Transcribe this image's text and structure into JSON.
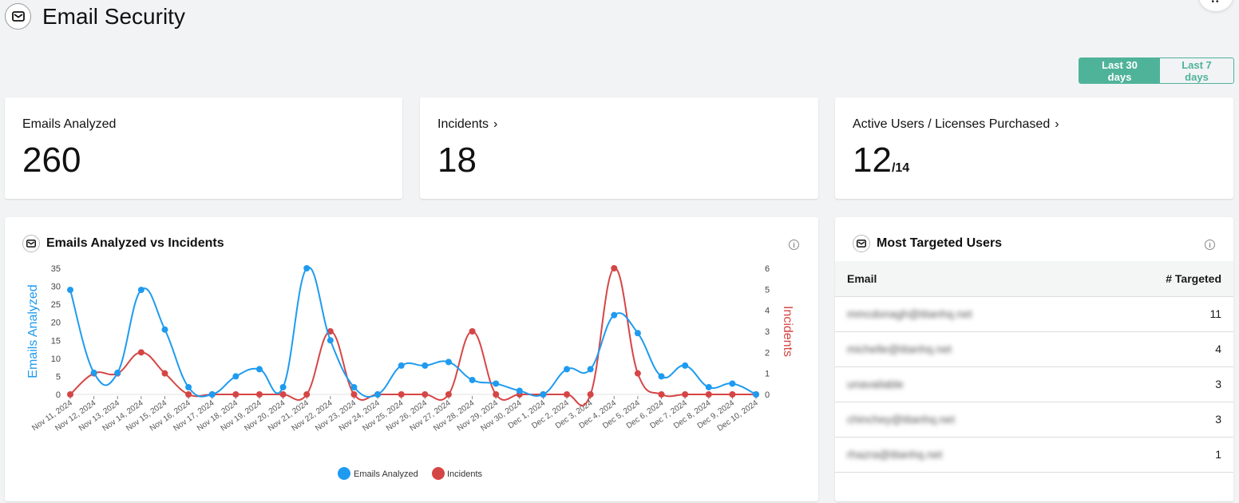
{
  "header": {
    "title": "Email Security",
    "icon": "envelope-icon"
  },
  "corner_button": {
    "label": "..."
  },
  "date_range": {
    "options": [
      "Last 30 days",
      "Last 7 days"
    ],
    "selected": "Last 30 days"
  },
  "stats": [
    {
      "label": "Emails Analyzed",
      "value": "260",
      "has_link": false
    },
    {
      "label": "Incidents",
      "value": "18",
      "has_link": true
    },
    {
      "label": "Active Users / Licenses Purchased",
      "value": "12",
      "suffix": "/14",
      "has_link": true
    }
  ],
  "chart_panel": {
    "title": "Emails Analyzed vs Incidents",
    "icon": "envelope-icon",
    "info_icon": "info-icon"
  },
  "colors": {
    "accent": "#4fb39a",
    "emails": "#1e9bf0",
    "incidents": "#d64545"
  },
  "chart_data": {
    "type": "line",
    "title": "Emails Analyzed vs Incidents",
    "categories": [
      "Nov 11, 2024",
      "Nov 12, 2024",
      "Nov 13, 2024",
      "Nov 14, 2024",
      "Nov 15, 2024",
      "Nov 16, 2024",
      "Nov 17, 2024",
      "Nov 18, 2024",
      "Nov 19, 2024",
      "Nov 20, 2024",
      "Nov 21, 2024",
      "Nov 22, 2024",
      "Nov 23, 2024",
      "Nov 24, 2024",
      "Nov 25, 2024",
      "Nov 26, 2024",
      "Nov 27, 2024",
      "Nov 28, 2024",
      "Nov 29, 2024",
      "Nov 30, 2024",
      "Dec 1, 2024",
      "Dec 2, 2024",
      "Dec 3, 2024",
      "Dec 4, 2024",
      "Dec 5, 2024",
      "Dec 6, 2024",
      "Dec 7, 2024",
      "Dec 8, 2024",
      "Dec 9, 2024",
      "Dec 10, 2024"
    ],
    "series": [
      {
        "name": "Emails Analyzed",
        "axis": "left",
        "color": "#1e9bf0",
        "values": [
          29,
          6,
          6,
          29,
          18,
          2,
          0,
          5,
          7,
          2,
          35,
          15,
          2,
          0,
          8,
          8,
          9,
          4,
          3,
          1,
          0,
          7,
          7,
          22,
          17,
          5,
          8,
          2,
          3,
          0
        ]
      },
      {
        "name": "Incidents",
        "axis": "right",
        "color": "#d64545",
        "values": [
          0,
          1,
          1,
          2,
          1,
          0,
          0,
          0,
          0,
          0,
          0,
          3,
          0,
          0,
          0,
          0,
          0,
          3,
          0,
          0,
          0,
          0,
          0,
          6,
          1,
          0,
          0,
          0,
          0,
          0
        ]
      }
    ],
    "ylabel": "Emails Analyzed",
    "y2label": "Incidents",
    "ylim": [
      0,
      35
    ],
    "y2lim": [
      0,
      6
    ],
    "yticks": [
      0,
      5,
      10,
      15,
      20,
      25,
      30,
      35
    ],
    "y2ticks": [
      0,
      1,
      2,
      3,
      4,
      5,
      6
    ],
    "legend": "bottom-center",
    "grid": false
  },
  "targeted_panel": {
    "title": "Most Targeted Users",
    "icon": "envelope-icon",
    "columns": [
      "Email",
      "# Targeted"
    ],
    "rows": [
      {
        "email": "mmcdonagh@titanhq.net",
        "count": "11"
      },
      {
        "email": "michelle@titanhq.net",
        "count": "4"
      },
      {
        "email": "unavailable",
        "count": "3"
      },
      {
        "email": "chinchey@titanhq.net",
        "count": "3"
      },
      {
        "email": "rhazra@titanhq.net",
        "count": "1"
      }
    ]
  }
}
